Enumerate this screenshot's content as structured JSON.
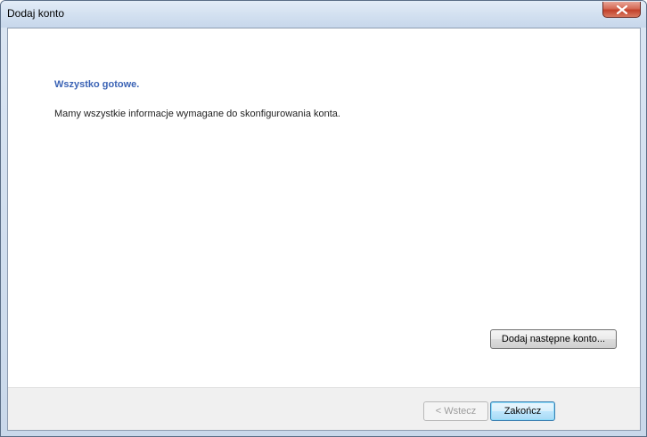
{
  "window": {
    "title": "Dodaj konto"
  },
  "content": {
    "heading": "Wszystko gotowe.",
    "message": "Mamy wszystkie informacje wymagane do skonfigurowania konta.",
    "add_another_label": "Dodaj następne konto..."
  },
  "footer": {
    "back_label": "< Wstecz",
    "finish_label": "Zakończ"
  },
  "colors": {
    "heading": "#3b63b5",
    "close_button": "#c2412a"
  },
  "icons": {
    "close": "close-icon"
  }
}
